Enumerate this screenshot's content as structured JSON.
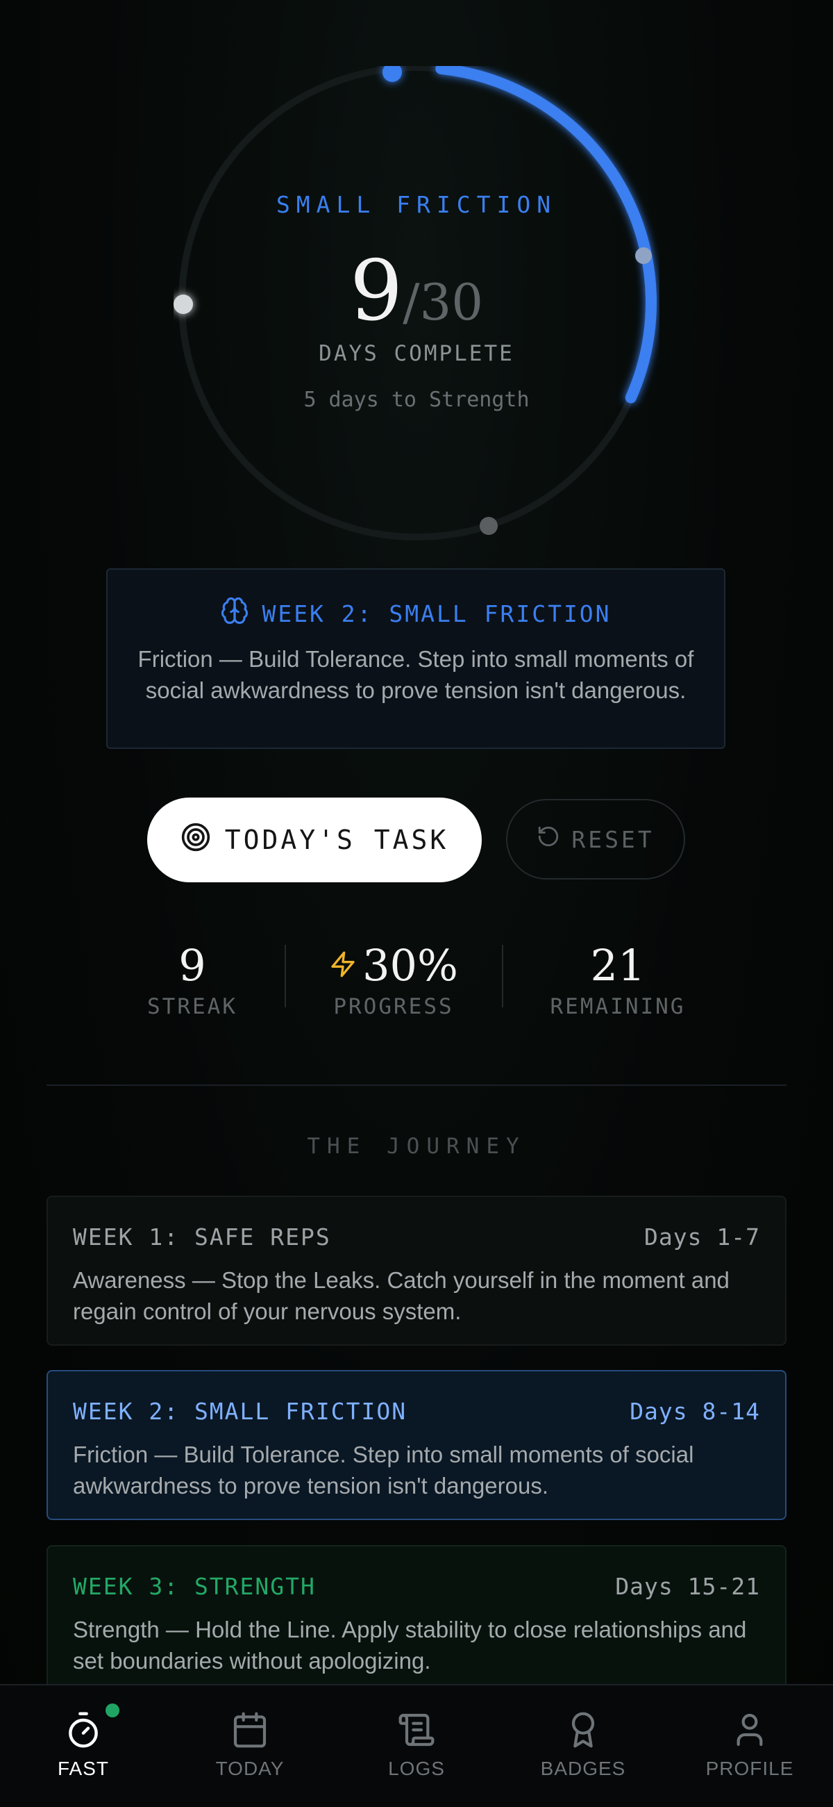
{
  "progress_ring": {
    "phase_label": "SMALL FRICTION",
    "days_done": "9",
    "slash": "/",
    "days_total": "30",
    "days_complete_label": "DAYS COMPLETE",
    "hint": "5 days to Strength",
    "progress_fraction": 0.3,
    "accent_color": "#3b7ff0"
  },
  "current_week": {
    "icon": "brain-icon",
    "title": "WEEK 2: SMALL FRICTION",
    "description": "Friction — Build Tolerance. Step into small moments of social awkwardness to prove tension isn't dangerous."
  },
  "actions": {
    "task_label": "TODAY'S TASK",
    "task_icon": "target-icon",
    "reset_label": "RESET",
    "reset_icon": "reset-icon"
  },
  "stats": {
    "streak_value": "9",
    "streak_label": "STREAK",
    "progress_value": "30%",
    "progress_label": "PROGRESS",
    "progress_icon": "lightning-icon",
    "remaining_value": "21",
    "remaining_label": "REMAINING"
  },
  "journey": {
    "title": "THE JOURNEY",
    "weeks": [
      {
        "title": "WEEK 1: SAFE REPS",
        "days": "Days 1-7",
        "text": "Awareness — Stop the Leaks. Catch yourself in the moment and regain control of your nervous system."
      },
      {
        "title": "WEEK 2: SMALL FRICTION",
        "days": "Days 8-14",
        "text": "Friction — Build Tolerance. Step into small moments of social awkwardness to prove tension isn't dangerous."
      },
      {
        "title": "WEEK 3: STRENGTH",
        "days": "Days 15-21",
        "text": "Strength — Hold the Line. Apply stability to close relationships and set boundaries without apologizing."
      }
    ]
  },
  "nav": {
    "items": [
      {
        "label": "FAST",
        "icon": "stopwatch-icon"
      },
      {
        "label": "TODAY",
        "icon": "calendar-icon"
      },
      {
        "label": "LOGS",
        "icon": "scroll-icon"
      },
      {
        "label": "BADGES",
        "icon": "award-icon"
      },
      {
        "label": "PROFILE",
        "icon": "user-icon"
      }
    ],
    "active": "FAST",
    "badge_color": "#1fa463"
  }
}
